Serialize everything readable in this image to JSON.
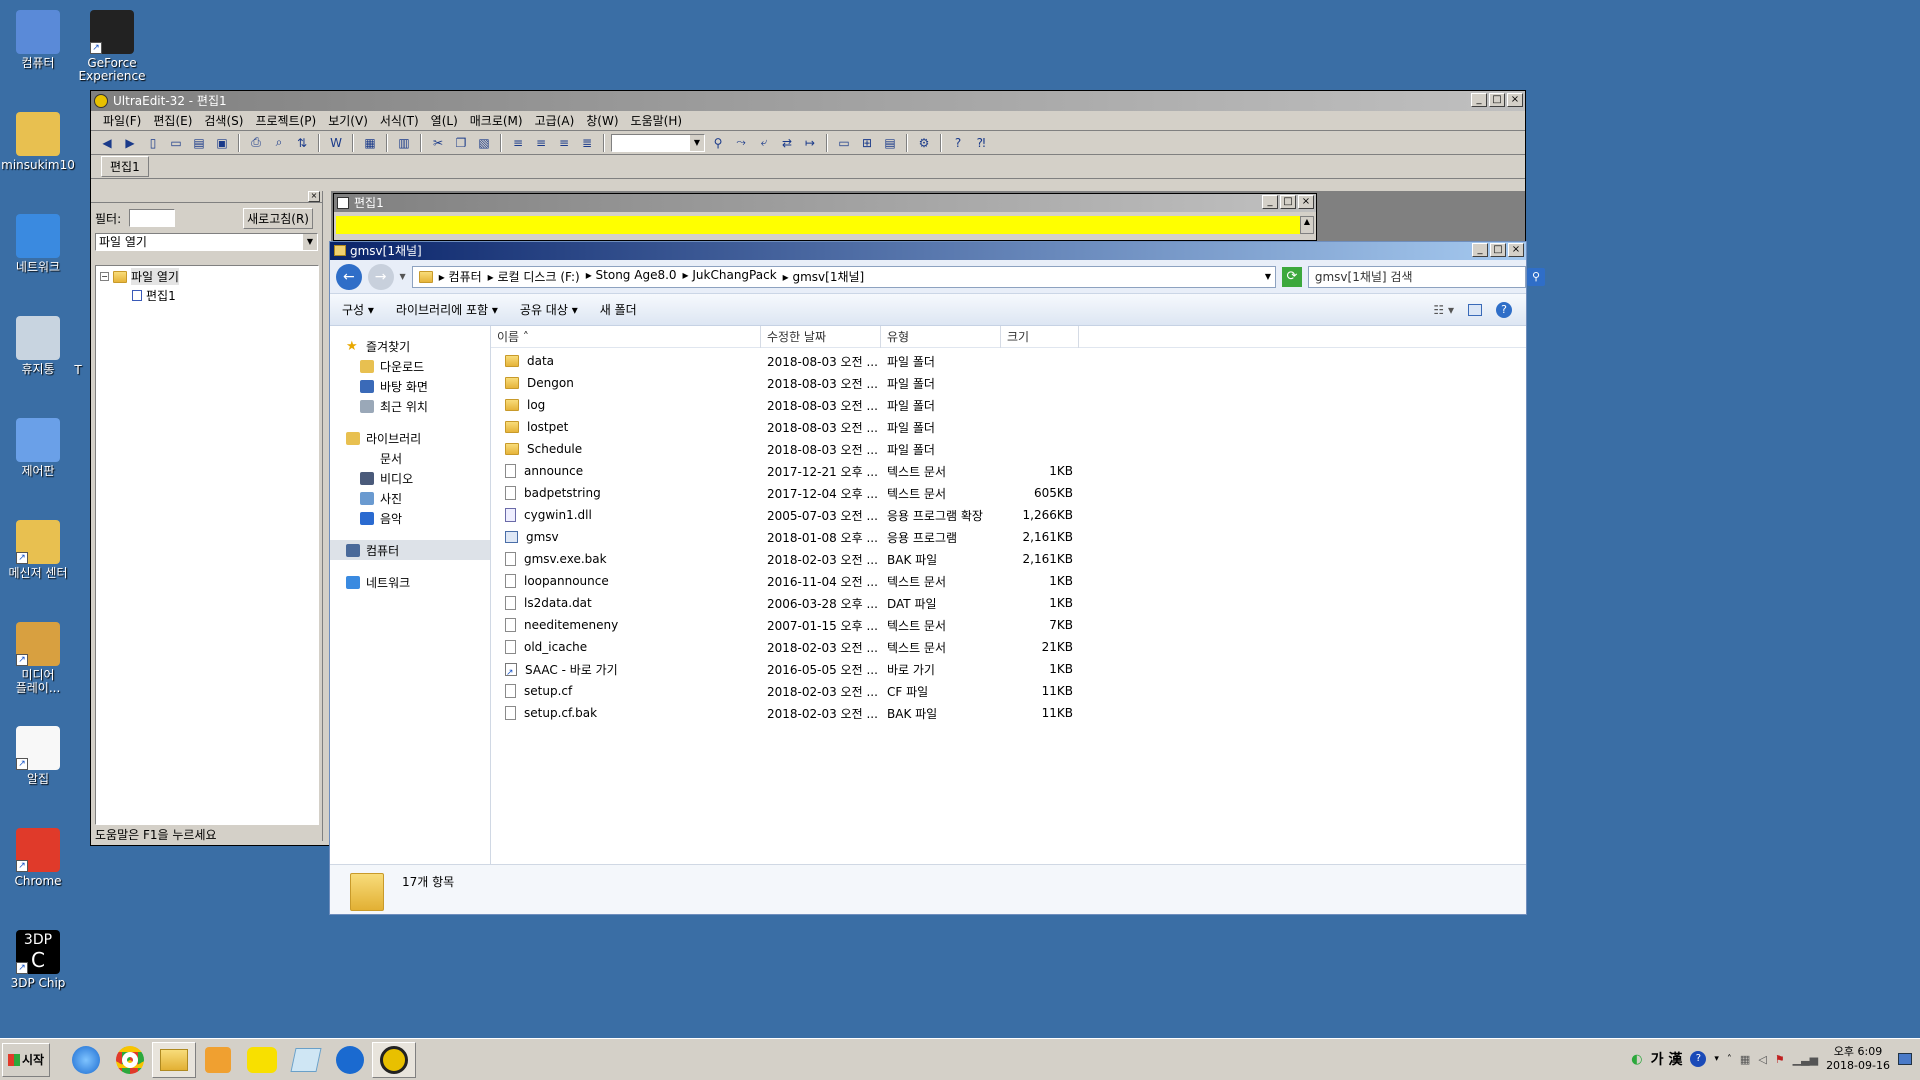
{
  "colors": {
    "desktop": "#3a6ea5",
    "highlight_yellow": "#ffff00",
    "title_active": "#0a246a"
  },
  "desktop_icons": [
    {
      "label": "컴퓨터",
      "icon": "computer-icon"
    },
    {
      "label": "GeForce\nExperience",
      "icon": "geforce-icon"
    },
    {
      "label": "minsukim10",
      "icon": "user-folder-icon"
    },
    {
      "label": "네트워크",
      "icon": "network-icon"
    },
    {
      "label": "휴지통",
      "icon": "recycle-bin-icon"
    },
    {
      "label": "제어판",
      "icon": "control-panel-icon"
    },
    {
      "label": "메신저 센터",
      "icon": "messenger-center-icon"
    },
    {
      "label": "미디어\n플레이...",
      "icon": "media-player-icon"
    },
    {
      "label": "알집",
      "icon": "alzip-icon"
    },
    {
      "label": "Chrome",
      "icon": "chrome-icon"
    },
    {
      "label": "3DP Chip",
      "icon": "3dp-chip-icon"
    }
  ],
  "desktop_partial_label": "T",
  "icon_3dp_text": "3DP",
  "icon_3dp_letter": "C",
  "ultraedit": {
    "title": "UltraEdit-32 - 편집1",
    "menu": [
      "파일(F)",
      "편집(E)",
      "검색(S)",
      "프로젝트(P)",
      "보기(V)",
      "서식(T)",
      "열(L)",
      "매크로(M)",
      "고급(A)",
      "창(W)",
      "도움말(H)"
    ],
    "tab_label": "편집1",
    "side": {
      "filter_label": "필터:",
      "refresh_button": "새로고침(R)",
      "dropdown_value": "파일 열기",
      "tree_root": "파일 열기",
      "tree_child": "편집1",
      "status": "도움말은 F1을 누르세요"
    },
    "editor_title": "편집1"
  },
  "explorer": {
    "title": "gmsv[1채널]",
    "breadcrumb": [
      "컴퓨터",
      "로컬 디스크 (F:)",
      "Stong Age8.0",
      "JukChangPack",
      "gmsv[1채널]"
    ],
    "search_placeholder": "gmsv[1채널] 검색",
    "commands": [
      "구성 ▾",
      "라이브러리에 포함 ▾",
      "공유 대상 ▾",
      "새 폴더"
    ],
    "nav": {
      "favorites": "즐겨찾기",
      "favorites_items": [
        "다운로드",
        "바탕 화면",
        "최근 위치"
      ],
      "libraries": "라이브러리",
      "libraries_items": [
        "문서",
        "비디오",
        "사진",
        "음악"
      ],
      "computer": "컴퓨터",
      "network": "네트워크"
    },
    "columns": [
      "이름",
      "수정한 날짜",
      "유형",
      "크기"
    ],
    "files": [
      {
        "name": "data",
        "date": "2018-08-03 오전 ...",
        "type": "파일 폴더",
        "size": "",
        "kind": "folder"
      },
      {
        "name": "Dengon",
        "date": "2018-08-03 오전 ...",
        "type": "파일 폴더",
        "size": "",
        "kind": "folder"
      },
      {
        "name": "log",
        "date": "2018-08-03 오전 ...",
        "type": "파일 폴더",
        "size": "",
        "kind": "folder"
      },
      {
        "name": "lostpet",
        "date": "2018-08-03 오전 ...",
        "type": "파일 폴더",
        "size": "",
        "kind": "folder"
      },
      {
        "name": "Schedule",
        "date": "2018-08-03 오전 ...",
        "type": "파일 폴더",
        "size": "",
        "kind": "folder"
      },
      {
        "name": "announce",
        "date": "2017-12-21 오후 ...",
        "type": "텍스트 문서",
        "size": "1KB",
        "kind": "file"
      },
      {
        "name": "badpetstring",
        "date": "2017-12-04 오후 ...",
        "type": "텍스트 문서",
        "size": "605KB",
        "kind": "file"
      },
      {
        "name": "cygwin1.dll",
        "date": "2005-07-03 오전 ...",
        "type": "응용 프로그램 확장",
        "size": "1,266KB",
        "kind": "dll"
      },
      {
        "name": "gmsv",
        "date": "2018-01-08 오후 ...",
        "type": "응용 프로그램",
        "size": "2,161KB",
        "kind": "exe"
      },
      {
        "name": "gmsv.exe.bak",
        "date": "2018-02-03 오전 ...",
        "type": "BAK 파일",
        "size": "2,161KB",
        "kind": "file"
      },
      {
        "name": "loopannounce",
        "date": "2016-11-04 오전 ...",
        "type": "텍스트 문서",
        "size": "1KB",
        "kind": "file"
      },
      {
        "name": "ls2data.dat",
        "date": "2006-03-28 오후 ...",
        "type": "DAT 파일",
        "size": "1KB",
        "kind": "file"
      },
      {
        "name": "needitemeneny",
        "date": "2007-01-15 오후 ...",
        "type": "텍스트 문서",
        "size": "7KB",
        "kind": "file"
      },
      {
        "name": "old_icache",
        "date": "2018-02-03 오전 ...",
        "type": "텍스트 문서",
        "size": "21KB",
        "kind": "file"
      },
      {
        "name": "SAAC - 바로 가기",
        "date": "2016-05-05 오전 ...",
        "type": "바로 가기",
        "size": "1KB",
        "kind": "lnk"
      },
      {
        "name": "setup.cf",
        "date": "2018-02-03 오전 ...",
        "type": "CF 파일",
        "size": "11KB",
        "kind": "file"
      },
      {
        "name": "setup.cf.bak",
        "date": "2018-02-03 오전 ...",
        "type": "BAK 파일",
        "size": "11KB",
        "kind": "file"
      }
    ],
    "status_count": "17개 항목"
  },
  "taskbar": {
    "start_label": "시작",
    "ime": "가 漢",
    "clock_time": "오후 6:09",
    "clock_date": "2018-09-16"
  }
}
